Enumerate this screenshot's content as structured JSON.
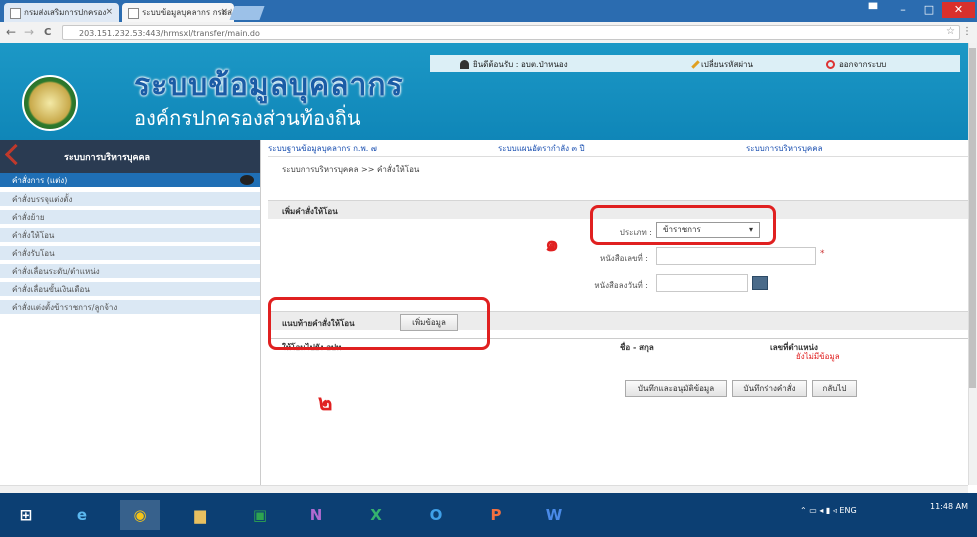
{
  "browser": {
    "tabs": [
      {
        "label": "กรมส่งเสริมการปกครอง"
      },
      {
        "label": "ระบบข้อมูลบุคลากร กรมส่งเสริม"
      }
    ],
    "url": "203.151.232.53:443/hrmsxl/transfer/main.do",
    "back": "←",
    "forward": "→",
    "reload": "C"
  },
  "header": {
    "title": "ระบบข้อมูลบุคลากร",
    "subtitle": "องค์กรปกครองส่วนท้องถิ่น",
    "user_label": "ยินดีต้อนรับ : อบต.ป่าหนอง",
    "change_password": "เปลี่ยนรหัสผ่าน",
    "logout": "ออกจากระบบ"
  },
  "topnav": [
    {
      "label": "ระบบฐานข้อมูลบุคลากร ก.พ. ๗"
    },
    {
      "label": "ระบบแผนอัตรากำลัง ๓ ปี"
    },
    {
      "label": "ระบบการบริหารบุคคล"
    }
  ],
  "sidebar": {
    "title": "ระบบการบริหารบุคคล",
    "items": [
      {
        "label": "คำสั่งการ (แต่ง)",
        "active": true
      },
      {
        "label": "คำสั่งบรรจุแต่งตั้ง"
      },
      {
        "label": "คำสั่งย้าย"
      },
      {
        "label": "คำสั่งให้โอน"
      },
      {
        "label": "คำสั่งรับโอน"
      },
      {
        "label": "คำสั่งเลื่อนระดับ/ตำแหน่ง"
      },
      {
        "label": "คำสั่งเลื่อนขั้นเงินเดือน"
      },
      {
        "label": "คำสั่งแต่งตั้งข้าราชการ/ลูกจ้าง"
      }
    ]
  },
  "main": {
    "breadcrumb": "ระบบการบริหารบุคคล >> คำสั่งให้โอน",
    "section1_title": "เพิ่มคำสั่งให้โอน",
    "type_label": "ประเภท :",
    "type_value": "ข้าราชการ",
    "doc_no_label": "หนังสือเลขที่ :",
    "doc_date_label": "หนังสือลงวันที่ :",
    "required_mark": "*",
    "section2_title": "แนบท้ายคำสั่งให้โอน",
    "add_data_button": "เพิ่มข้อมูล",
    "col_transfer": "ให้โอนไปยัง อปท.",
    "col_name": "ชื่อ - สกุล",
    "col_position_no": "เลขที่ตำแหน่ง",
    "no_data": "ยังไม่มีข้อมูล",
    "btn_save_temp": "บันทึกและอนุมัติข้อมูล",
    "btn_save_order": "บันทึกร่างคำสั่ง",
    "btn_back": "กลับไป"
  },
  "annotations": {
    "num1": "๑",
    "num2": "๒"
  },
  "taskbar": {
    "icons": [
      {
        "glyph": "⊞",
        "name": "start"
      },
      {
        "glyph": "e",
        "name": "ie"
      },
      {
        "glyph": "◉",
        "name": "chrome"
      },
      {
        "glyph": "▆",
        "name": "explorer"
      },
      {
        "glyph": "▣",
        "name": "store"
      },
      {
        "glyph": "N",
        "name": "onenote"
      },
      {
        "glyph": "X",
        "name": "excel"
      },
      {
        "glyph": "O",
        "name": "outlook"
      },
      {
        "glyph": "P",
        "name": "powerpoint"
      },
      {
        "glyph": "W",
        "name": "word"
      }
    ],
    "tray": "ENG",
    "time": "11:48 AM"
  },
  "colors": {
    "header_blue": "#1c98c6",
    "sidebar_dark": "#2a3b52",
    "annotation_red": "#e02020",
    "taskbar": "#0c3f73"
  }
}
